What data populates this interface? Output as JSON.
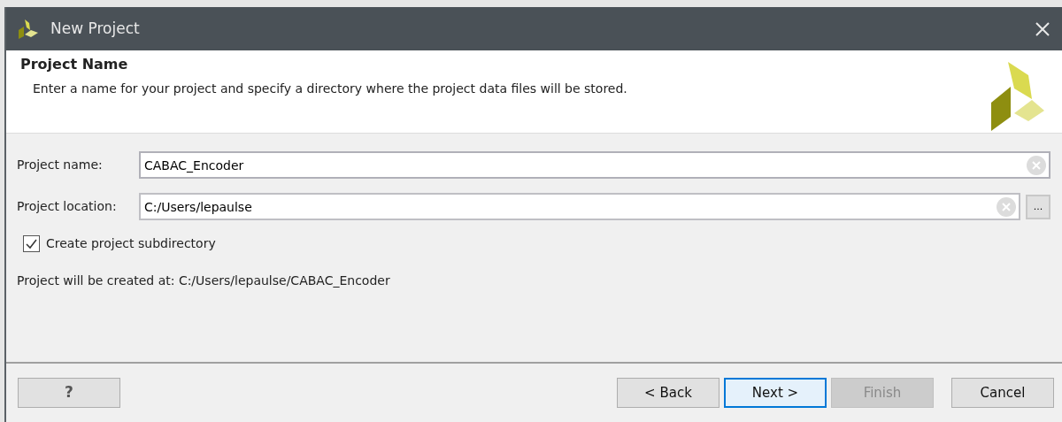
{
  "window": {
    "title": "New Project"
  },
  "header": {
    "title": "Project Name",
    "description": "Enter a name for your project and specify a directory where the project data files will be stored."
  },
  "fields": [
    {
      "label": "Project name:",
      "value": "CABAC_Encoder",
      "focused": true,
      "browse": false
    },
    {
      "label": "Project location:",
      "value": "C:/Users/lepaulse",
      "focused": false,
      "browse": true,
      "browse_label": "..."
    }
  ],
  "subdirectory": {
    "label": "Create project subdirectory",
    "checked": true
  },
  "result": "Project will be created at: C:/Users/lepaulse/CABAC_Encoder",
  "help_button": "?",
  "buttons": [
    {
      "label": "< Back",
      "disabled": false,
      "default": false
    },
    {
      "label": "Next >",
      "disabled": false,
      "default": true
    },
    {
      "label": "Finish",
      "disabled": true,
      "default": false
    },
    {
      "label": "Cancel",
      "disabled": false,
      "default": false
    }
  ]
}
